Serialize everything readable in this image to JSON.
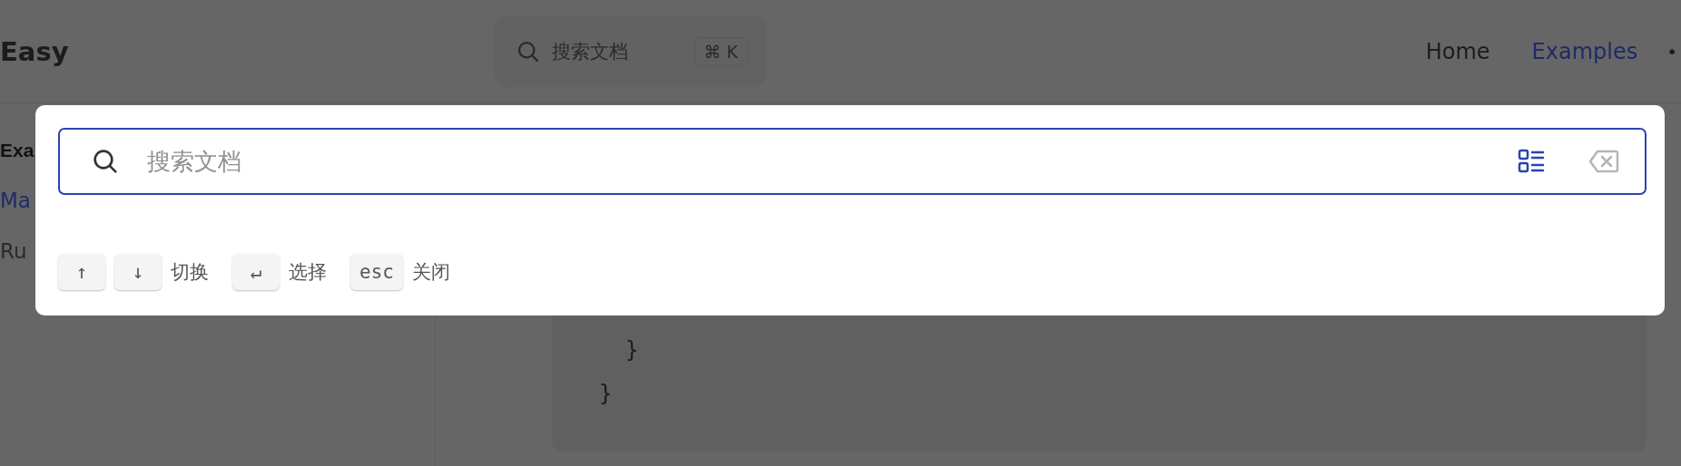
{
  "header": {
    "logo": "Easy",
    "search": {
      "label": "搜索文档",
      "shortcut": "⌘ K"
    },
    "nav": [
      {
        "label": "Home",
        "selected": false
      },
      {
        "label": "Examples",
        "selected": true
      }
    ],
    "more": "•"
  },
  "sidebar": {
    "heading": "Exa",
    "items": [
      {
        "label": "Ma",
        "selected": true
      },
      {
        "label": "Ru",
        "selected": false
      }
    ]
  },
  "code": {
    "lines": [
      "  }",
      "}"
    ]
  },
  "search_modal": {
    "placeholder": "搜索文档",
    "hints": [
      {
        "keys": [
          "↑",
          "↓"
        ],
        "label": "切换"
      },
      {
        "keys": [
          "↵"
        ],
        "label": "选择"
      },
      {
        "keys": [
          "esc"
        ],
        "label": "关闭"
      }
    ]
  }
}
